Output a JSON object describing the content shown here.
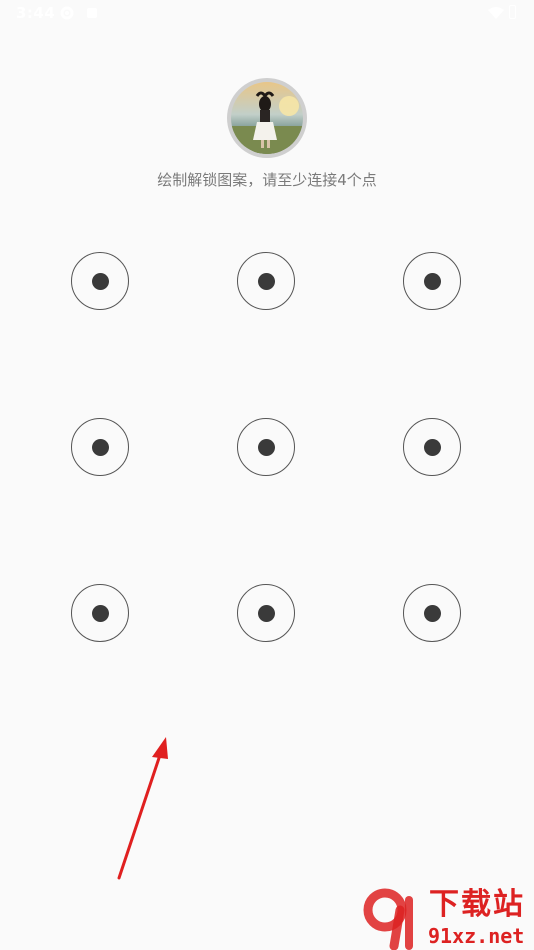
{
  "status_bar": {
    "time": "3:44",
    "icons": [
      "settings-gear-icon",
      "sim-card-icon",
      "wifi-icon",
      "battery-icon"
    ]
  },
  "lock_screen": {
    "avatar": "user-avatar",
    "instruction": "绘制解锁图案，请至少连接4个点",
    "pattern_grid": {
      "rows": 3,
      "cols": 3,
      "dots": [
        "dot-1",
        "dot-2",
        "dot-3",
        "dot-4",
        "dot-5",
        "dot-6",
        "dot-7",
        "dot-8",
        "dot-9"
      ]
    }
  },
  "annotation": {
    "arrow_color": "#e02020"
  },
  "watermark": {
    "title": "下载站",
    "url": "91xz.net",
    "color": "#dd2222"
  }
}
